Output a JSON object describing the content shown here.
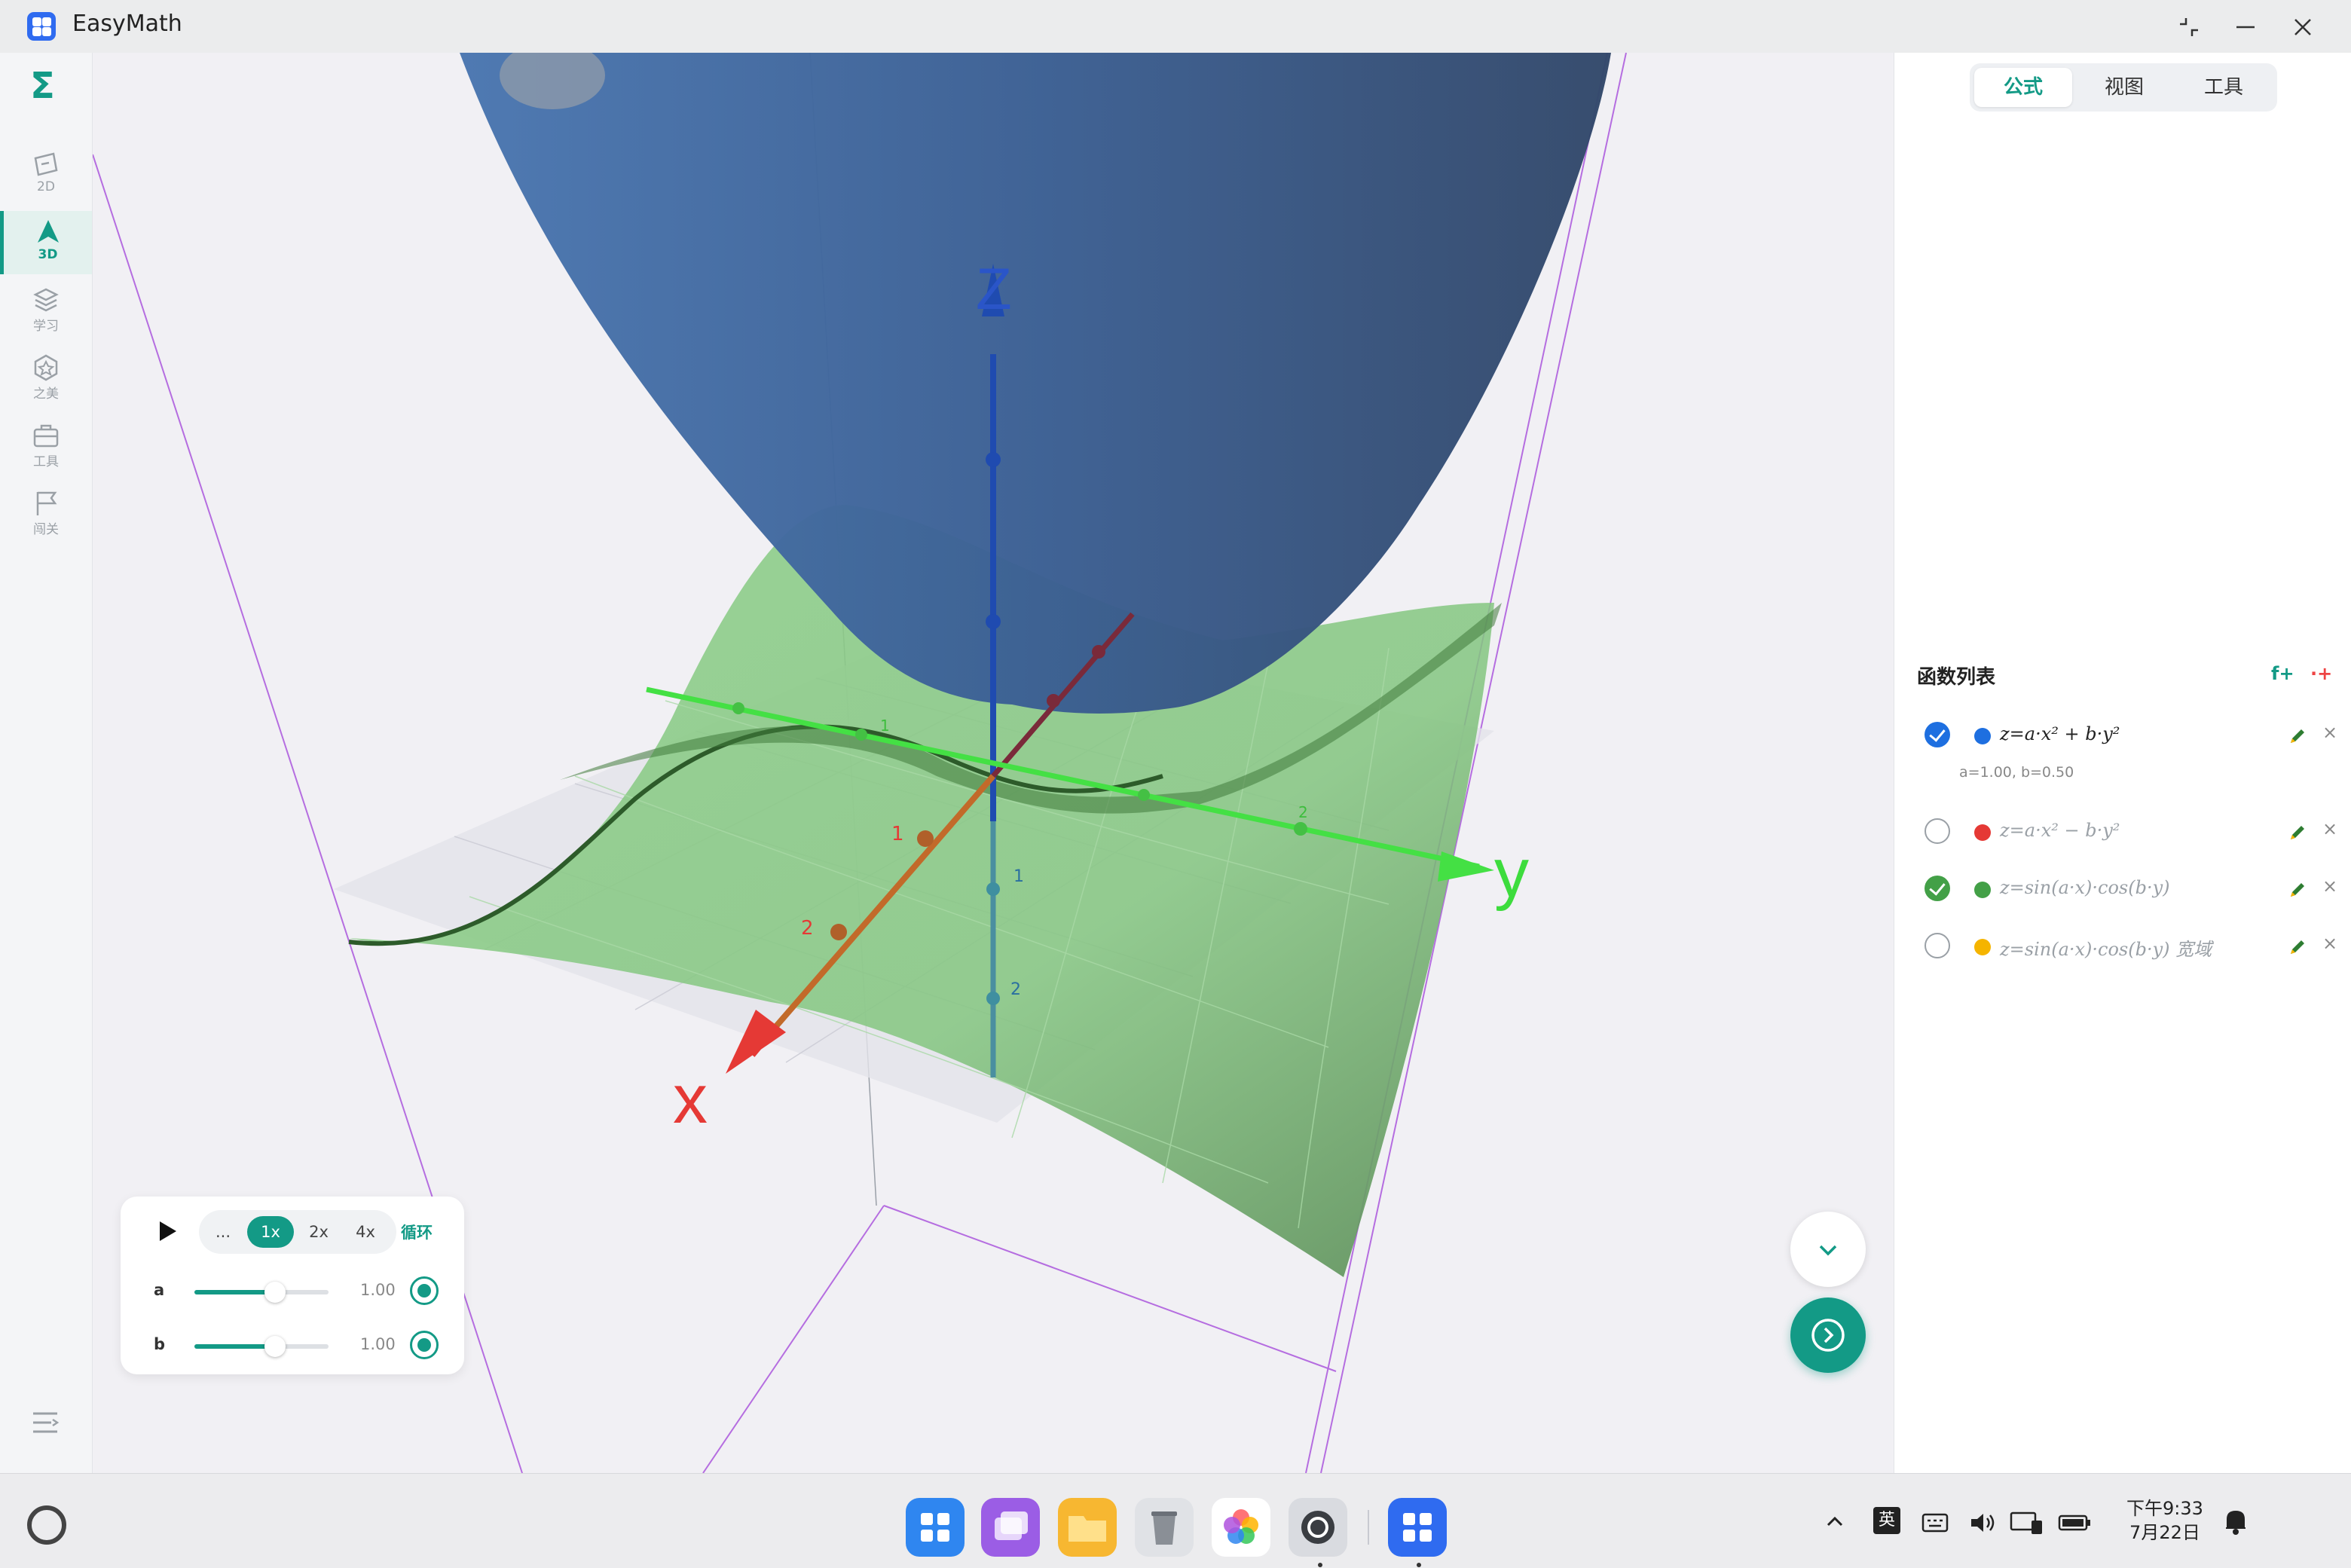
{
  "window": {
    "title": "EasyMath"
  },
  "sidebar": {
    "logo": "Σ",
    "items": [
      {
        "label": "2D",
        "icon": "plane-icon"
      },
      {
        "label": "3D",
        "icon": "arrow-3d-icon",
        "active": true
      },
      {
        "label": "学习",
        "icon": "layers-icon"
      },
      {
        "label": "之美",
        "icon": "star-badge-icon"
      },
      {
        "label": "工具",
        "icon": "toolbox-icon"
      },
      {
        "label": "闯关",
        "icon": "flag-icon"
      }
    ]
  },
  "canvas": {
    "axes": {
      "x": {
        "label": "x",
        "ticks": [
          "1",
          "2"
        ],
        "color": "#e53935"
      },
      "y": {
        "label": "y",
        "ticks": [
          "1",
          "2"
        ],
        "color": "#3ddc3d"
      },
      "z": {
        "label": "Z",
        "ticks": [
          "1",
          "2"
        ],
        "color": "#2a55c8"
      }
    }
  },
  "right_panel": {
    "tabs": [
      "公式",
      "视图",
      "工具"
    ],
    "active_tab": "公式",
    "list_title": "函数列表",
    "add_function": "f+",
    "add_point": "·+",
    "functions": [
      {
        "formula": "z=a·x² + b·y²",
        "color": "#1e6fe0",
        "checked": true,
        "check_color": "#1e6fe0",
        "params": "a=1.00, b=0.50"
      },
      {
        "formula": "z=a·x² − b·y²",
        "color": "#e53935",
        "checked": false
      },
      {
        "formula": "z=sin(a·x)·cos(b·y)",
        "color": "#43a047",
        "checked": true,
        "check_color": "#43a047"
      },
      {
        "formula": "z=sin(a·x)·cos(b·y) 宽域",
        "color": "#f5b400",
        "checked": false
      }
    ]
  },
  "animation": {
    "play": "play-icon",
    "speeds": [
      "...",
      "1x",
      "2x",
      "4x"
    ],
    "active_speed": "1x",
    "loop_label": "循环",
    "sliders": [
      {
        "name": "a",
        "value": "1.00",
        "fraction": 0.6
      },
      {
        "name": "b",
        "value": "1.00",
        "fraction": 0.6
      }
    ]
  },
  "taskbar": {
    "apps": [
      "launcher-icon",
      "multitask-icon",
      "files-icon",
      "trash-icon",
      "photos-icon",
      "settings-icon",
      "easymath-icon"
    ],
    "tray": {
      "ime": "英",
      "time": "下午9:33",
      "date": "7月22日"
    }
  }
}
